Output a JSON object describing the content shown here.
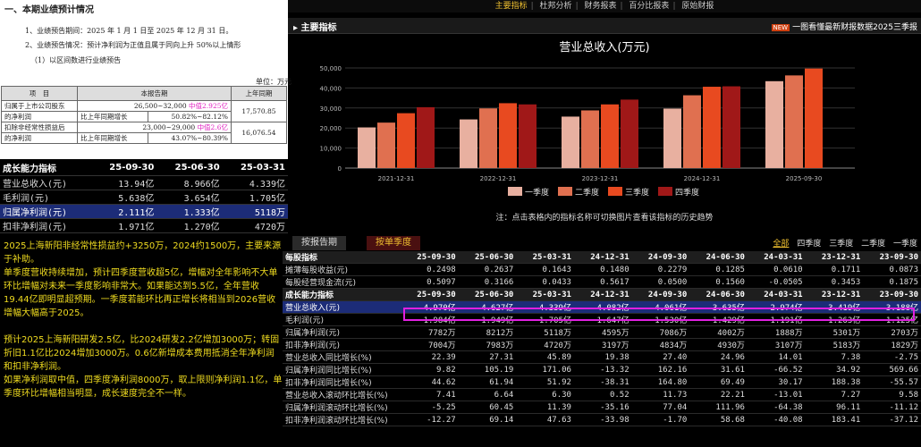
{
  "doc": {
    "heading": "一、本期业绩预计情况",
    "line1": "1、业绩预告期间：2025 年 1 月 1 日至 2025 年 12 月 31 日。",
    "line2": "2、业绩预告情况：预计净利润为正值且属于同向上升 50%以上情形",
    "line3": "（1）以区间数进行业绩预告",
    "unit": "单位：万元",
    "col_item": "项　目",
    "col_current": "本报告期",
    "col_last": "上年同期",
    "r1_label_a": "归属于上市公司股东",
    "r1_label_b": "的净利润",
    "r1_range": "26,500~32,000",
    "r1_mid": "中值2.925亿",
    "r1_growth_label": "比上年同期增长",
    "r1_growth": "50.82%~82.12%",
    "r1_last": "17,570.85",
    "r2_label_a": "扣除非经常性损益后",
    "r2_label_b": "的净利润",
    "r2_range": "23,000~29,000",
    "r2_mid": "中值2.6亿",
    "r2_growth_label": "比上年同期增长",
    "r2_growth": "43.07%~80.39%",
    "r2_last": "16,076.54"
  },
  "growth": {
    "head": [
      "成长能力指标",
      "25-09-30",
      "25-06-30",
      "25-03-31"
    ],
    "rows": [
      [
        "营业总收入(元)",
        "13.94亿",
        "8.966亿",
        "4.339亿"
      ],
      [
        "毛利润(元)",
        "5.638亿",
        "3.654亿",
        "1.705亿"
      ],
      [
        "归属净利润(元)",
        "2.111亿",
        "1.333亿",
        "5118万"
      ],
      [
        "扣非净利润(元)",
        "1.971亿",
        "1.270亿",
        "4720万"
      ]
    ]
  },
  "notes": {
    "p1": "2025上海新阳非经常性损益约+3250万，2024约1500万，主要来源于补助。",
    "p1b": "单季度营收持续增加，预计四季度营收超5亿，增幅对全年影响不大单环比增幅对未来一季度影响非常大。如果能达到5.5亿，全年营收19.44亿即明显超预期。一季度若能环比再正增长将相当到2026营收增幅大幅高于2025。",
    "p2": "预计2025上海新阳研发2.5亿，比2024研发2.2亿增加3000万；转固折旧1.1亿比2024增加3000万。0.6亿新增成本费用抵消全年净利润和扣非净利润。",
    "p2b": "如果净利润取中值，四季度净利润8000万，取上限则净利润1.1亿，单季度环比增幅相当明显，成长速度完全不一样。"
  },
  "nav": [
    "主要指标",
    "杜邦分析",
    "财务报表",
    "百分比报表",
    "原始财报"
  ],
  "bar": {
    "title": "主要指标",
    "new": "NEW",
    "promo": "一图看懂最新财报数据2025三季报"
  },
  "chart_data": {
    "type": "bar",
    "title": "营业总收入(万元)",
    "years": [
      "2021-12-31",
      "2022-12-31",
      "2023-12-31",
      "2024-12-31",
      "2025-09-30"
    ],
    "series": [
      {
        "name": "一季度",
        "color": "#e8b0a0",
        "values": [
          20300,
          24300,
          25700,
          29700,
          43390
        ]
      },
      {
        "name": "二季度",
        "color": "#e07050",
        "values": [
          22700,
          29800,
          28800,
          36350,
          46270
        ]
      },
      {
        "name": "三季度",
        "color": "#e84a20",
        "values": [
          27400,
          32400,
          31800,
          40610,
          49700
        ]
      },
      {
        "name": "四季度",
        "color": "#a01818",
        "values": [
          30400,
          31800,
          34190,
          40820,
          null
        ]
      }
    ],
    "yticks": [
      "0",
      "10,000",
      "20,000",
      "30,000",
      "40,000",
      "50,000"
    ],
    "ylim": [
      0,
      50000
    ]
  },
  "note": "注：点击表格内的指标名称可切换图片查看该指标的历史趋势",
  "tabs": [
    "按报告期",
    "按单季度"
  ],
  "filters": [
    "全部",
    "四季度",
    "三季度",
    "二季度",
    "一季度"
  ],
  "main": {
    "sec1": [
      "每股指标",
      "25-09-30",
      "25-06-30",
      "25-03-31",
      "24-12-31",
      "24-09-30",
      "24-06-30",
      "24-03-31",
      "23-12-31",
      "23-09-30"
    ],
    "sec1_rows": [
      [
        "摊薄每股收益(元)",
        "0.2498",
        "0.2637",
        "0.1643",
        "0.1480",
        "0.2279",
        "0.1285",
        "0.0610",
        "0.1711",
        "0.0873"
      ],
      [
        "每股经营现金流(元)",
        "0.5097",
        "0.3166",
        "0.0433",
        "0.5617",
        "0.0500",
        "0.1560",
        "-0.0505",
        "0.3453",
        "0.1875"
      ]
    ],
    "sec2": [
      "成长能力指标",
      "25-09-30",
      "25-06-30",
      "25-03-31",
      "24-12-31",
      "24-09-30",
      "24-06-30",
      "24-03-31",
      "23-12-31",
      "23-09-30"
    ],
    "sec2_rows": [
      [
        "营业总收入(元)",
        "4.970亿",
        "4.627亿",
        "4.339亿",
        "4.082亿",
        "4.061亿",
        "3.635亿",
        "2.974亿",
        "3.419亿",
        "3.188亿"
      ],
      [
        "毛利润(元)",
        "1.984亿",
        "1.949亿",
        "1.705亿",
        "1.647亿",
        "1.530亿",
        "1.429亿",
        "1.191亿",
        "1.263亿",
        "1.125亿"
      ],
      [
        "归属净利润(元)",
        "7782万",
        "8212万",
        "5118万",
        "4595万",
        "7086万",
        "4002万",
        "1888万",
        "5301万",
        "2703万"
      ],
      [
        "扣非净利润(元)",
        "7004万",
        "7983万",
        "4720万",
        "3197万",
        "4834万",
        "4930万",
        "3107万",
        "5183万",
        "1829万"
      ],
      [
        "营业总收入同比增长(%)",
        "22.39",
        "27.31",
        "45.89",
        "19.38",
        "27.40",
        "24.96",
        "14.01",
        "7.38",
        "-2.75"
      ],
      [
        "归属净利润同比增长(%)",
        "9.82",
        "105.19",
        "171.06",
        "-13.32",
        "162.16",
        "31.61",
        "-66.52",
        "34.92",
        "569.66"
      ],
      [
        "扣非净利润同比增长(%)",
        "44.62",
        "61.94",
        "51.92",
        "-38.31",
        "164.80",
        "69.49",
        "30.17",
        "188.38",
        "-55.57"
      ],
      [
        "营业总收入滚动环比增长(%)",
        "7.41",
        "6.64",
        "6.30",
        "0.52",
        "11.73",
        "22.21",
        "-13.01",
        "7.27",
        "9.58"
      ],
      [
        "归属净利润滚动环比增长(%)",
        "-5.25",
        "60.45",
        "11.39",
        "-35.16",
        "77.04",
        "111.96",
        "-64.38",
        "96.11",
        "-11.12"
      ],
      [
        "扣非净利润滚动环比增长(%)",
        "-12.27",
        "69.14",
        "47.63",
        "-33.98",
        "-1.70",
        "58.68",
        "-40.08",
        "183.41",
        "-37.12"
      ]
    ]
  }
}
